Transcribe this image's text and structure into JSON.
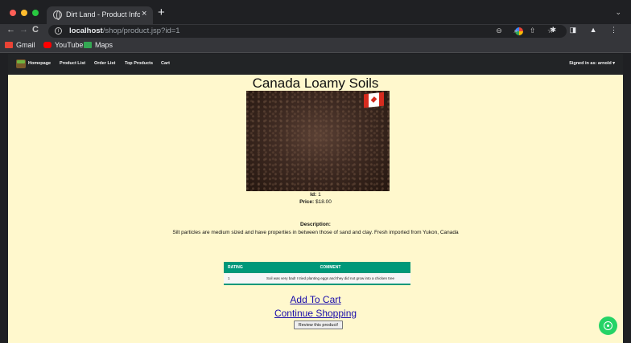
{
  "browser": {
    "tab_title": "Dirt Land - Product Information",
    "tab_close": "×",
    "new_tab": "+",
    "tabs_menu": "⌄",
    "back": "←",
    "forward": "→",
    "reload": "C",
    "url_host": "localhost",
    "url_path": "/shop/product.jsp?id=1",
    "omni_icons": "⊖ ⌕ ⇧ ☆",
    "ext_icons": "✱ ◨ ▲ ⋮",
    "bookmarks": [
      {
        "label": "Gmail",
        "icon": "gmail-icon",
        "color": "#ea4335"
      },
      {
        "label": "YouTube",
        "icon": "youtube-icon",
        "color": "#ff0000"
      },
      {
        "label": "Maps",
        "icon": "maps-icon",
        "color": "#34a853"
      }
    ]
  },
  "site_nav": {
    "links": [
      "Homepage",
      "Product List",
      "Order List",
      "Top Products",
      "Cart"
    ],
    "signed_in": "Signed in as: arnold ▾"
  },
  "product": {
    "name": "Canada Loamy Soils",
    "id_label": "Id:",
    "id": "1",
    "price_label": "Price:",
    "price": "$18.00",
    "description_label": "Description:",
    "description": "Silt particles are medium sized and have properties in between those of sand and clay. Fresh imported from Yukon, Canada",
    "image": "soil-photo with canadian-flag-icon"
  },
  "reviews": {
    "headers": [
      "RATING",
      "COMMENT"
    ],
    "rows": [
      {
        "rating": "1",
        "comment": "Soil was very bad! I tried planting eggs and they did not grow into a chicken tree"
      }
    ]
  },
  "actions": {
    "add_to_cart": "Add To Cart",
    "continue_shopping": "Continue Shopping",
    "review_button": "Review this product!"
  },
  "colors": {
    "page_bg": "#fff8cd",
    "nav_bg": "#222426",
    "table_header": "#009879",
    "link": "#1a0dab",
    "chat_button": "#25d366"
  }
}
